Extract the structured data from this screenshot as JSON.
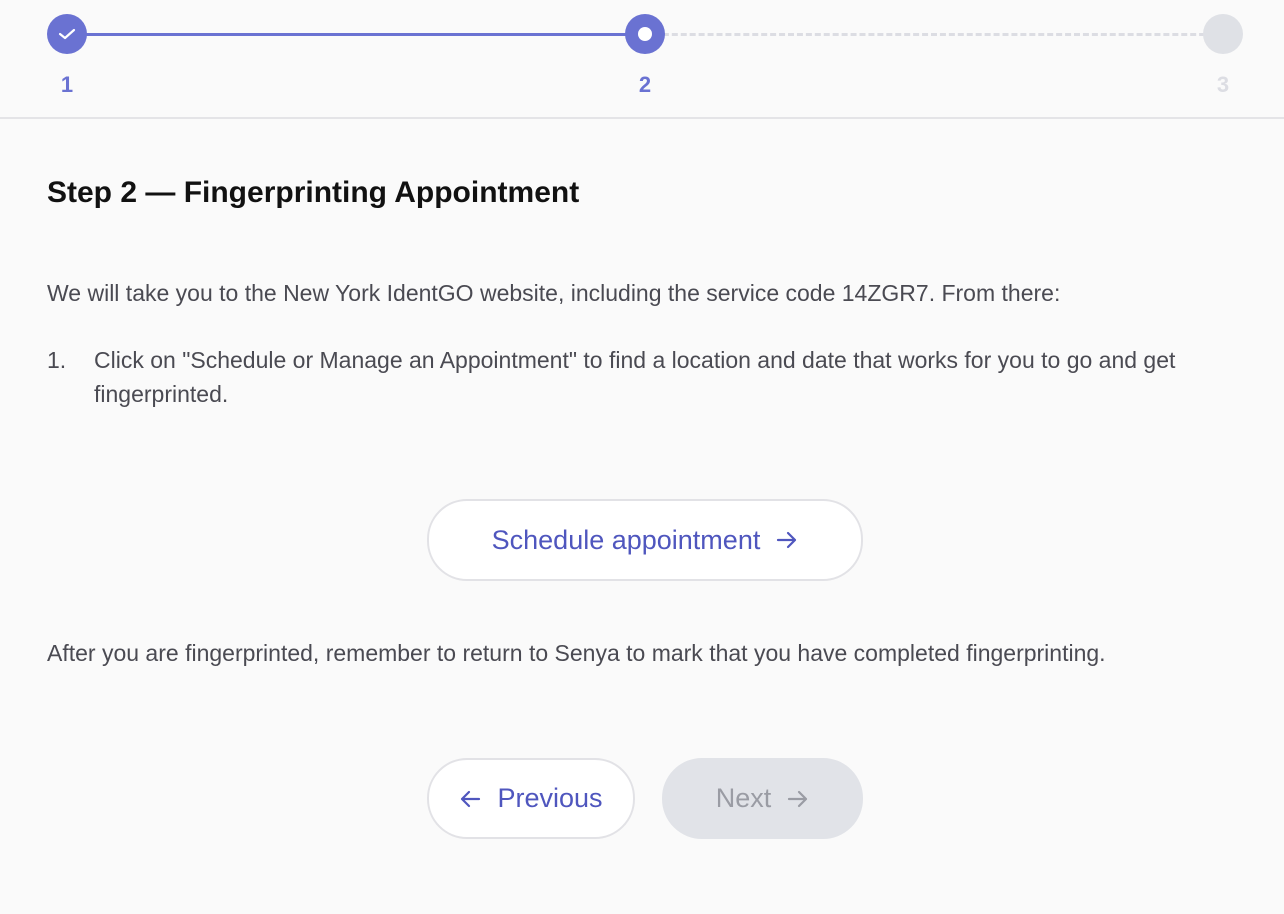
{
  "stepper": {
    "steps": [
      {
        "label": "1",
        "state": "complete",
        "icon": "check-icon"
      },
      {
        "label": "2",
        "state": "current"
      },
      {
        "label": "3",
        "state": "upcoming"
      }
    ],
    "colors": {
      "active": "#6a72d2",
      "inactive": "#dfe1e6"
    }
  },
  "content": {
    "title": "Step 2 — Fingerprinting Appointment",
    "intro": "We will take you to the New York IdentGO website, including the service code 14ZGR7. From there:",
    "instructions": [
      {
        "number": "1.",
        "text": "Click on \"Schedule or Manage an Appointment\" to find a location and date that works for you to go and get fingerprinted."
      }
    ],
    "schedule_button": {
      "label": "Schedule appointment",
      "icon": "arrow-right-icon"
    },
    "after_note": "After you are fingerprinted, remember to return to Senya to mark that you have completed fingerprinting."
  },
  "navigation": {
    "previous": {
      "label": "Previous",
      "icon": "arrow-left-icon",
      "enabled": true
    },
    "next": {
      "label": "Next",
      "icon": "arrow-right-icon",
      "enabled": false
    }
  },
  "colors": {
    "accent": "#4f56be",
    "background": "#fafafa",
    "disabled_bg": "#e1e3e8"
  }
}
